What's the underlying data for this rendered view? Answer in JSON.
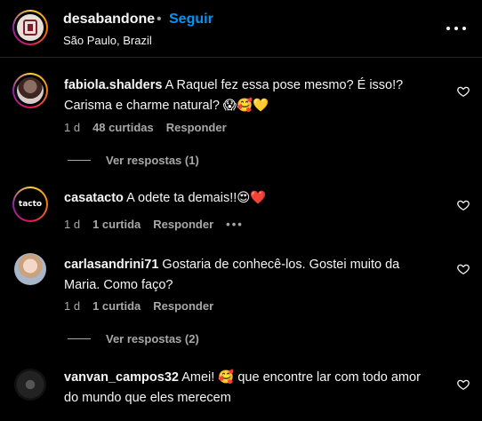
{
  "header": {
    "username": "desabandone",
    "dot": "•",
    "follow_label": "Seguir",
    "location": "São Paulo, Brazil"
  },
  "comments": [
    {
      "username": "fabiola.shalders",
      "text": " A Raquel fez essa pose mesmo? É isso!? Carisma e charme natural? 😱🥰💛",
      "time": "1 d",
      "likes": "48 curtidas",
      "reply": "Responder",
      "view_replies": "Ver respostas (1)"
    },
    {
      "username": "casatacto",
      "text": " A odete ta demais!!😍❤️",
      "time": "1 d",
      "likes": "1 curtida",
      "reply": "Responder",
      "more": "•••"
    },
    {
      "username": "carlasandrini71",
      "text": " Gostaria de conhecê-los. Gostei muito da Maria. Como faço?",
      "time": "1 d",
      "likes": "1 curtida",
      "reply": "Responder",
      "view_replies": "Ver respostas (2)"
    },
    {
      "username": "vanvan_campos32",
      "text": " Amei! 🥰 que encontre lar com todo amor do mundo que eles merecem"
    }
  ],
  "avatars": {
    "casatacto_logo": "tacto"
  },
  "colors": {
    "background": "#000000",
    "text": "#f5f5f5",
    "secondary": "#a8a8a8",
    "link": "#0095f6"
  }
}
